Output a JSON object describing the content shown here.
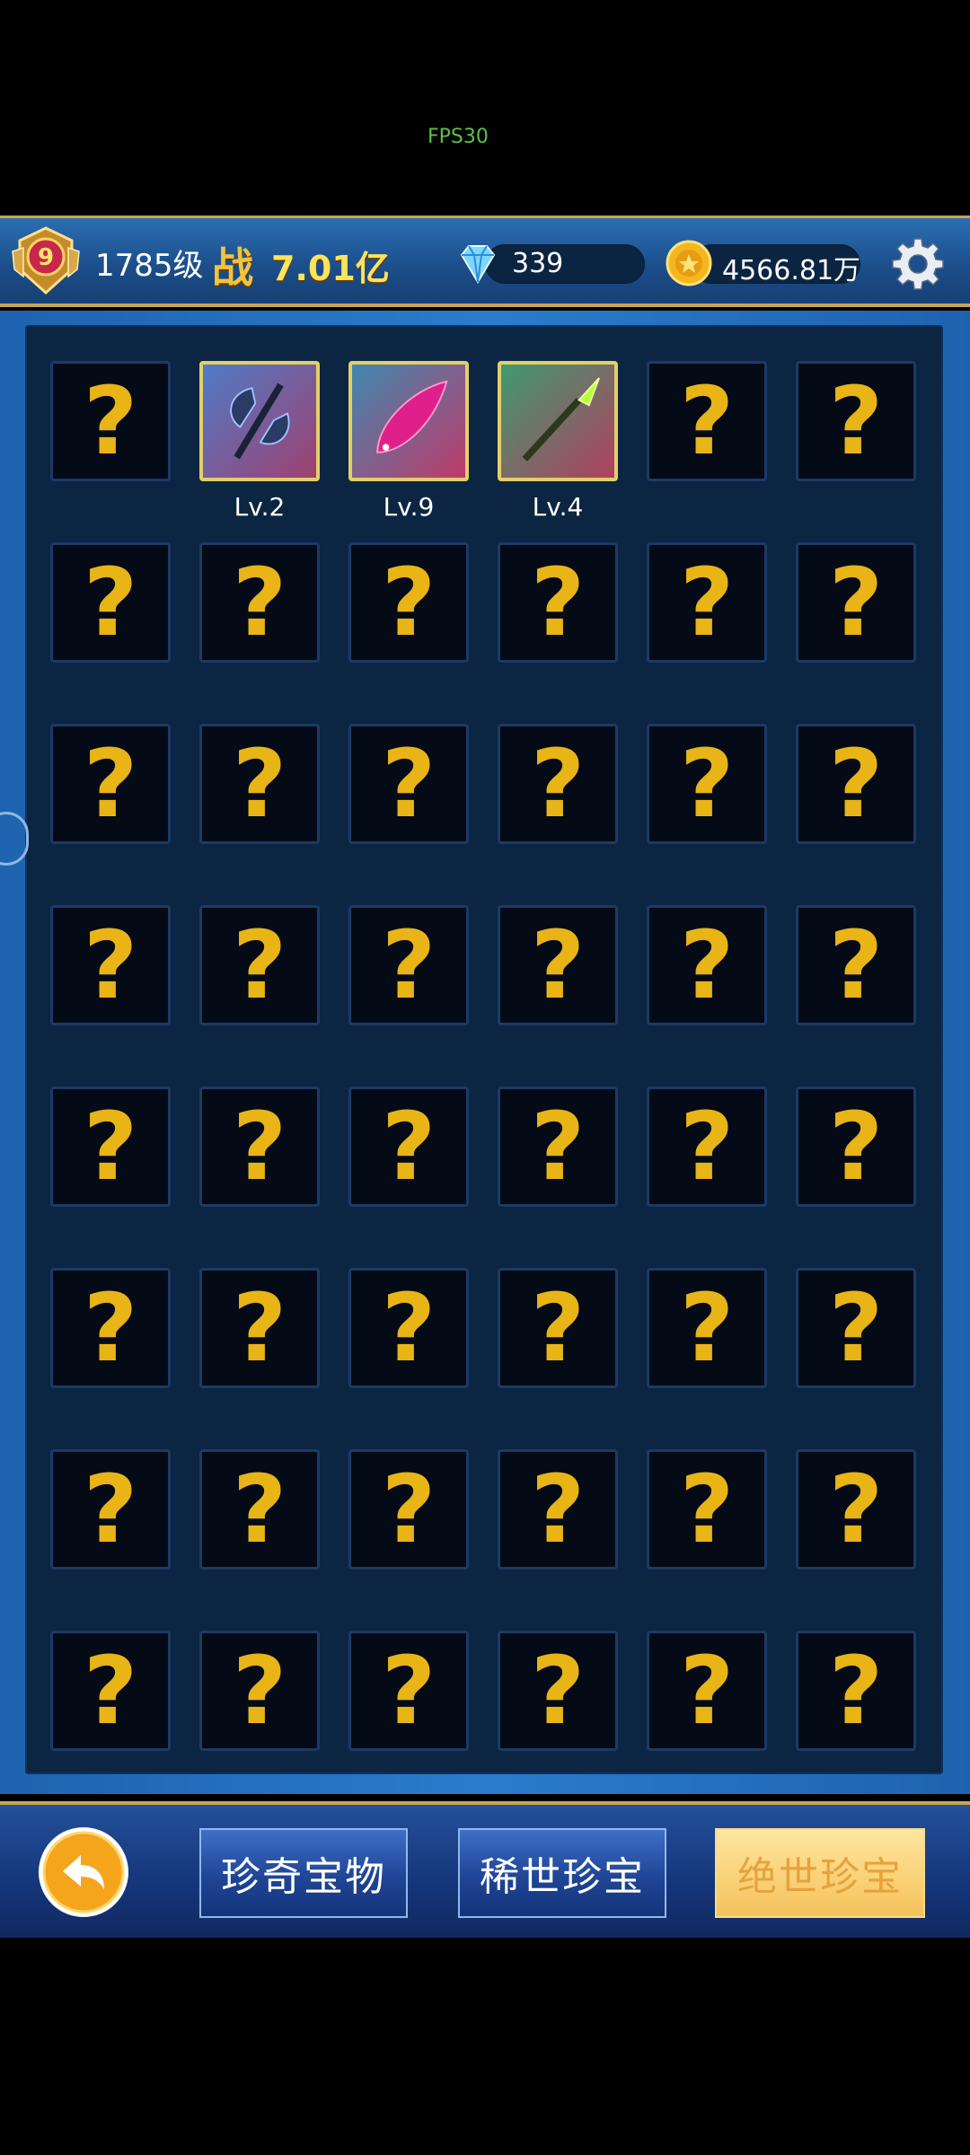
{
  "status": {
    "fps": "FPS30"
  },
  "header": {
    "vip_level": "9",
    "player_level": "1785级",
    "power_label": "战",
    "power_value": "7.01亿",
    "diamonds": "339",
    "gold": "4566.81万"
  },
  "collection": {
    "slots": [
      {
        "state": "unknown",
        "symbol": "?"
      },
      {
        "state": "owned",
        "item": "battle-axe",
        "level": "Lv.2"
      },
      {
        "state": "owned",
        "item": "crimson-feather-blade",
        "level": "Lv.9"
      },
      {
        "state": "owned",
        "item": "jade-spear",
        "level": "Lv.4"
      },
      {
        "state": "unknown",
        "symbol": "?"
      },
      {
        "state": "unknown",
        "symbol": "?"
      }
    ],
    "unknown_symbol": "?"
  },
  "footer": {
    "tabs": [
      "珍奇宝物",
      "稀世珍宝",
      "绝世珍宝"
    ],
    "selected_tab": "绝世珍宝"
  },
  "colors": {
    "accent_gold": "#e8b416",
    "panel": "#0b2542",
    "bar_blue": "#1c4f8c"
  }
}
